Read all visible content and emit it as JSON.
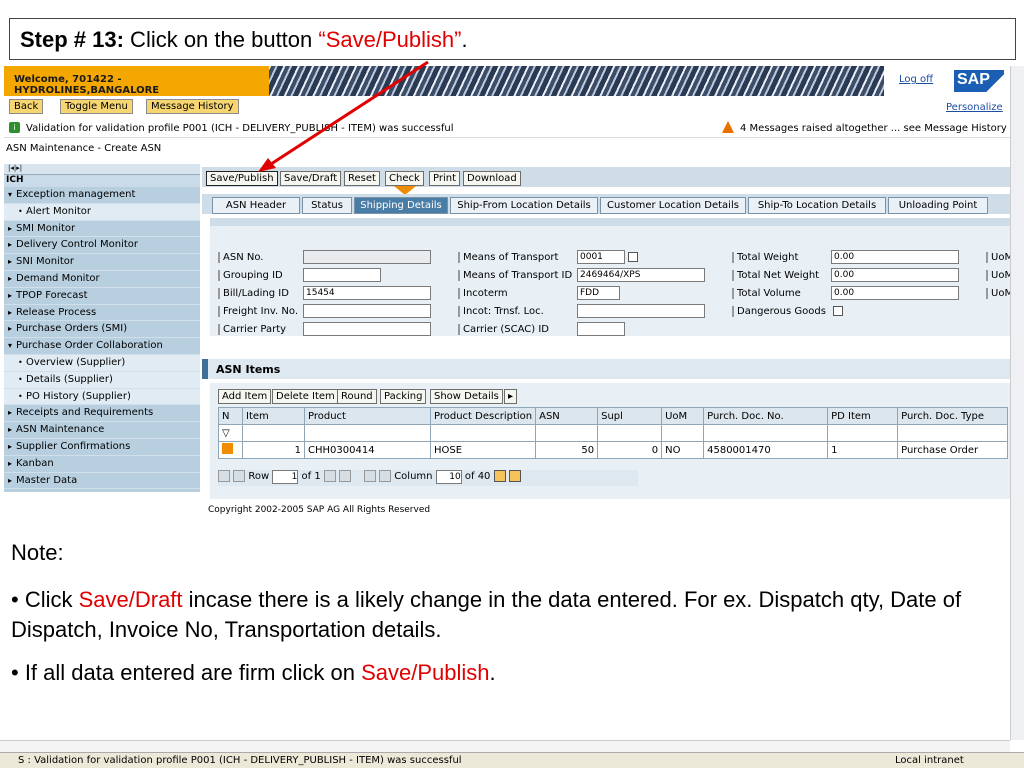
{
  "step": {
    "prefix": "Step # 13:",
    "text": " Click on the button ",
    "highlight": "“Save/Publish”",
    "suffix": "."
  },
  "header": {
    "welcome": "Welcome, 701422 - HYDROLINES,BANGALORE",
    "logoff": "Log off",
    "logo": "SAP",
    "buttons": [
      "Back",
      "Toggle Menu",
      "Message History"
    ],
    "personalize": "Personalize"
  },
  "messages": {
    "info": "Validation for validation profile P001 (ICH - DELIVERY_PUBLISH - ITEM) was successful",
    "warning": "4 Messages raised altogether ... see Message History"
  },
  "page_title": "ASN Maintenance - Create ASN",
  "nav": {
    "top": "|◂|▸|",
    "ich": "ICH",
    "items": [
      {
        "label": "Exception management",
        "type": "open"
      },
      {
        "label": "Alert Monitor",
        "type": "sub"
      },
      {
        "label": "SMI Monitor",
        "type": "closed"
      },
      {
        "label": "Delivery Control Monitor",
        "type": "closed"
      },
      {
        "label": "SNI Monitor",
        "type": "closed"
      },
      {
        "label": "Demand Monitor",
        "type": "closed"
      },
      {
        "label": "TPOP Forecast",
        "type": "closed"
      },
      {
        "label": "Release Process",
        "type": "closed"
      },
      {
        "label": "Purchase Orders (SMI)",
        "type": "closed"
      },
      {
        "label": "Purchase Order Collaboration",
        "type": "open"
      },
      {
        "label": "Overview (Supplier)",
        "type": "sub"
      },
      {
        "label": "Details (Supplier)",
        "type": "sub"
      },
      {
        "label": "PO History (Supplier)",
        "type": "sub"
      },
      {
        "label": "Receipts and Requirements",
        "type": "closed"
      },
      {
        "label": "ASN Maintenance",
        "type": "closed"
      },
      {
        "label": "Supplier Confirmations",
        "type": "closed"
      },
      {
        "label": "Kanban",
        "type": "closed"
      },
      {
        "label": "Master Data",
        "type": "closed"
      }
    ]
  },
  "actions": [
    "Save/Publish",
    "Save/Draft",
    "Reset",
    "Check",
    "Print",
    "Download"
  ],
  "tabs": [
    "ASN Header",
    "Status",
    "Shipping Details",
    "Ship-From Location Details",
    "Customer Location Details",
    "Ship-To Location Details",
    "Unloading Point"
  ],
  "form": {
    "asn_no": {
      "label": "ASN No.",
      "value": ""
    },
    "grouping_id": {
      "label": "Grouping ID",
      "value": ""
    },
    "bill_lading": {
      "label": "Bill/Lading ID",
      "value": "15454"
    },
    "freight_inv": {
      "label": "Freight Inv. No.",
      "value": ""
    },
    "carrier_party": {
      "label": "Carrier Party",
      "value": ""
    },
    "means_transport": {
      "label": "Means of Transport",
      "value": "0001"
    },
    "means_transport_id": {
      "label": "Means of Transport ID",
      "value": "2469464/XPS"
    },
    "incoterm": {
      "label": "Incoterm",
      "value": "FDD"
    },
    "incot_trnsf": {
      "label": "Incot: Trnsf. Loc.",
      "value": ""
    },
    "carrier_scac": {
      "label": "Carrier (SCAC) ID",
      "value": ""
    },
    "total_weight": {
      "label": "Total Weight",
      "value": "0.00"
    },
    "total_net_weight": {
      "label": "Total Net Weight",
      "value": "0.00"
    },
    "total_volume": {
      "label": "Total Volume",
      "value": "0.00"
    },
    "dangerous_goods": {
      "label": "Dangerous Goods"
    },
    "uom_labels": [
      "UoM",
      "UoM",
      "UoM"
    ]
  },
  "items": {
    "title": "ASN Items",
    "buttons": [
      "Add Item",
      "Delete Item",
      "Round",
      "Packing",
      "Show Details"
    ],
    "columns": [
      "N",
      "Item",
      "Product",
      "Product Description",
      "ASN",
      "Supl",
      "UoM",
      "Purch. Doc. No.",
      "PD Item",
      "Purch. Doc. Type"
    ],
    "row": {
      "item": "1",
      "product": "CHH0300414",
      "description": "HOSE",
      "asn": "50",
      "supl": "0",
      "uom": "NO",
      "doc_no": "4580001470",
      "pd_item": "1",
      "doc_type": "Purchase Order"
    },
    "pager": {
      "row_label": "Row",
      "row": "1",
      "of_rows": "of 1",
      "col_label": "Column",
      "col": "10",
      "of_cols": "of 40"
    }
  },
  "copyright": "Copyright 2002-2005 SAP AG All Rights Reserved",
  "note": {
    "title": "Note:",
    "b1_pre": "• Click ",
    "b1_red": "Save/Draft",
    "b1_post": " incase there is a likely change in the data entered. For ex. Dispatch qty, Date of Dispatch, Invoice No, Transportation details.",
    "b2_pre": "• If all data entered are firm click on ",
    "b2_red": "Save/Publish",
    "b2_post": "."
  },
  "status_bar": {
    "text": "S : Validation for validation profile P001 (ICH - DELIVERY_PUBLISH - ITEM) was successful",
    "zone": "Local intranet"
  },
  "colors": {
    "accent_red": "#e00000",
    "sap_orange": "#f4a700",
    "tab_active": "#4a7da6"
  }
}
